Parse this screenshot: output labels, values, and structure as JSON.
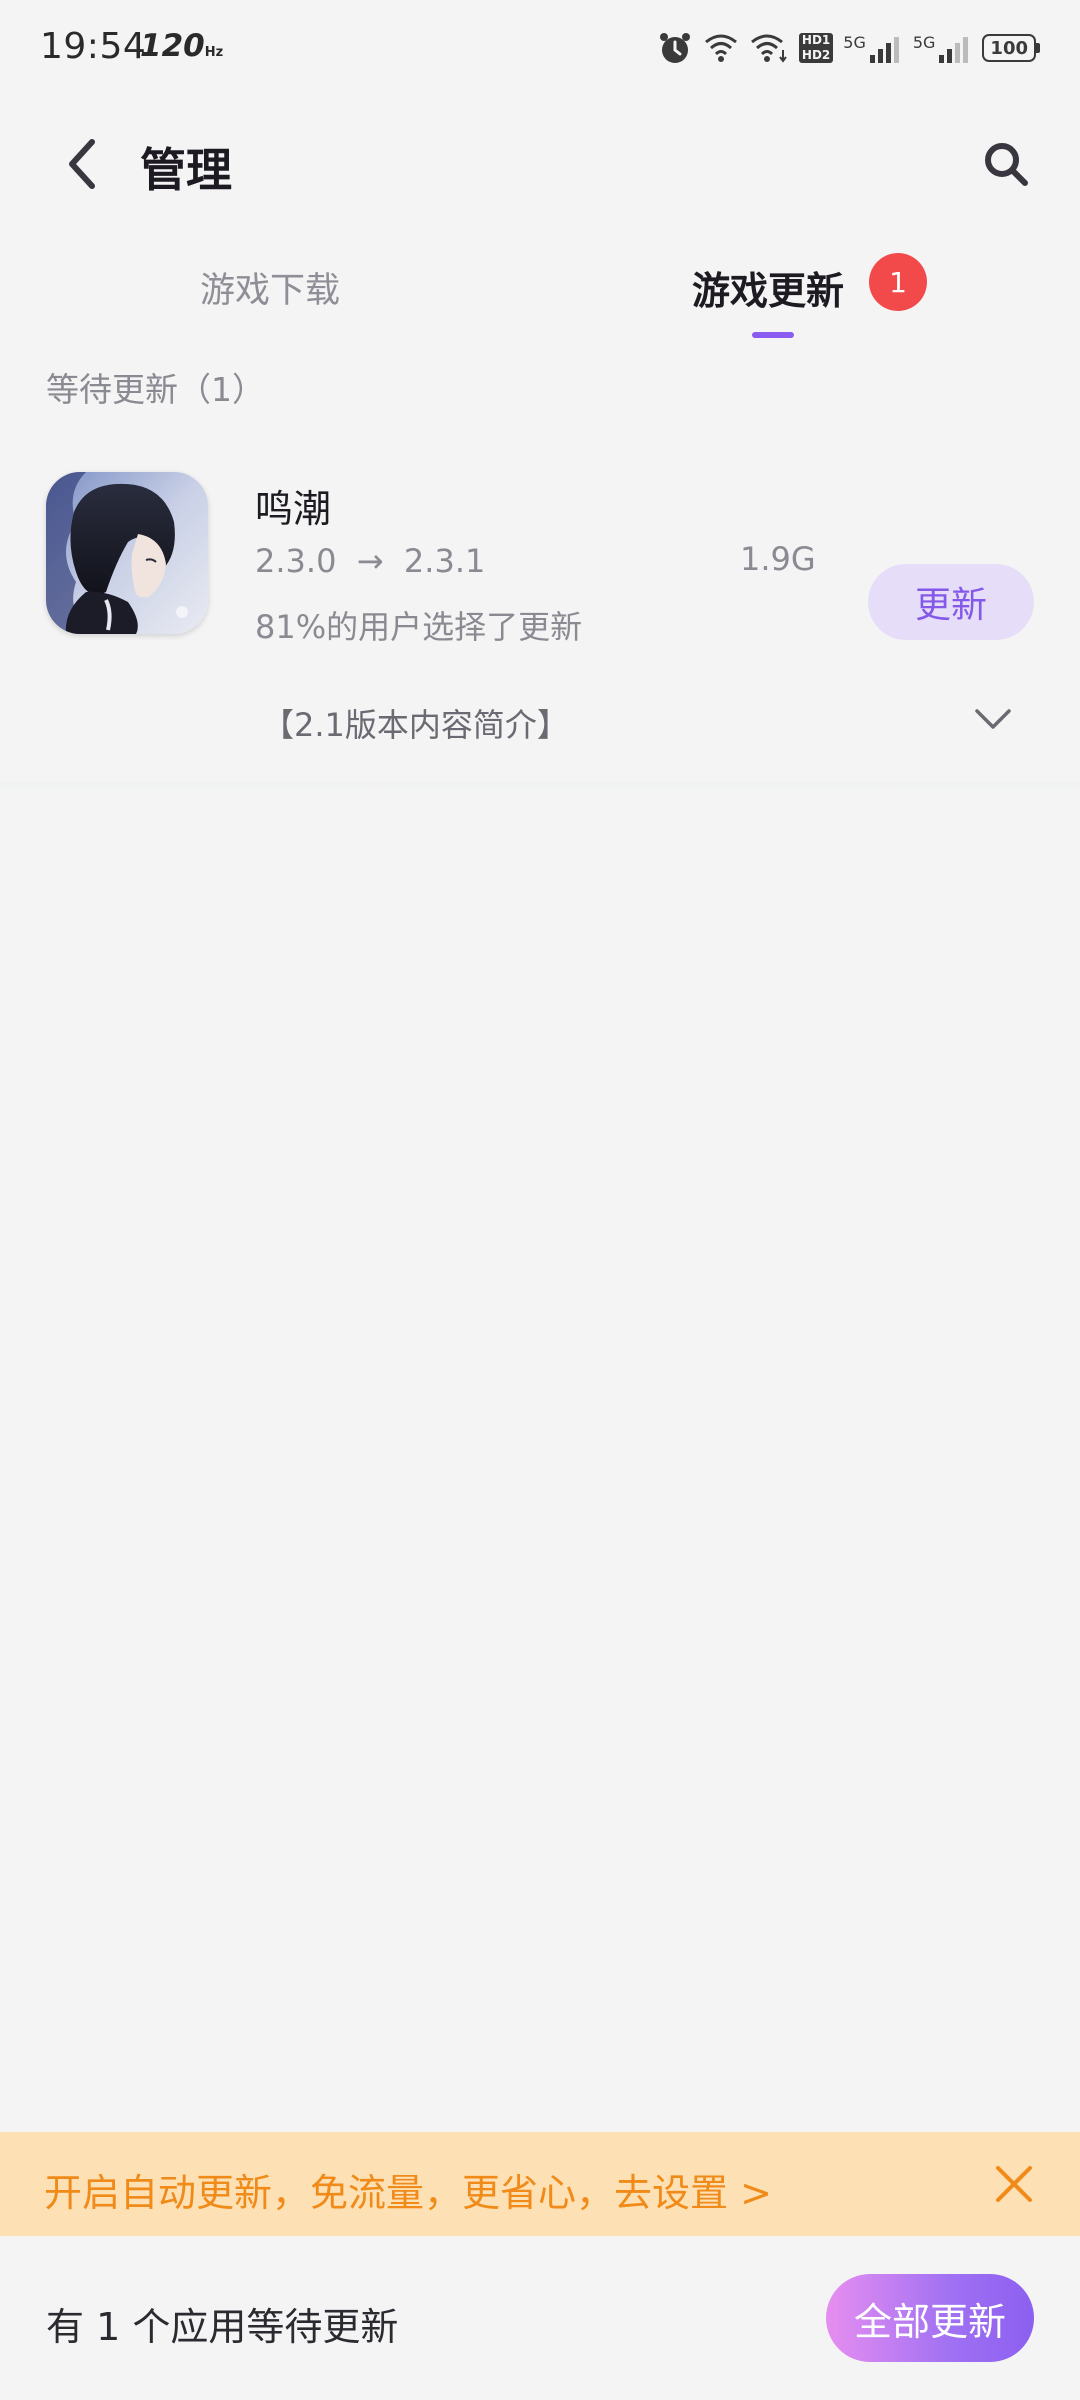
{
  "status_bar": {
    "time": "19:54",
    "refresh_rate": "120",
    "refresh_unit": "Hz",
    "network_type_1": "5G",
    "network_type_2": "5G",
    "hd_1": "HD1",
    "hd_2": "HD2",
    "battery": "100"
  },
  "header": {
    "title": "管理"
  },
  "tabs": [
    {
      "label": "游戏下载",
      "active": false
    },
    {
      "label": "游戏更新",
      "active": true,
      "badge": "1"
    }
  ],
  "section": {
    "header": "等待更新（1）"
  },
  "game": {
    "name": "鸣潮",
    "from_version": "2.3.0",
    "arrow": "→",
    "to_version": "2.3.1",
    "size": "1.9G",
    "user_choice": "81%的用户选择了更新",
    "update_label": "更新",
    "release_notes": "【2.1版本内容简介】"
  },
  "banner": {
    "text": "开启自动更新，免流量，更省心，去设置 >"
  },
  "bottom": {
    "pending_text": "有 1 个应用等待更新",
    "update_all_label": "全部更新"
  },
  "colors": {
    "accent": "#8a5cf0",
    "badge": "#f24a4a",
    "banner_bg": "#fde0b4",
    "banner_text": "#f08a18"
  },
  "icons": {
    "back": "chevron-left-icon",
    "search": "search-icon",
    "expand": "chevron-down-icon",
    "close": "close-icon"
  }
}
